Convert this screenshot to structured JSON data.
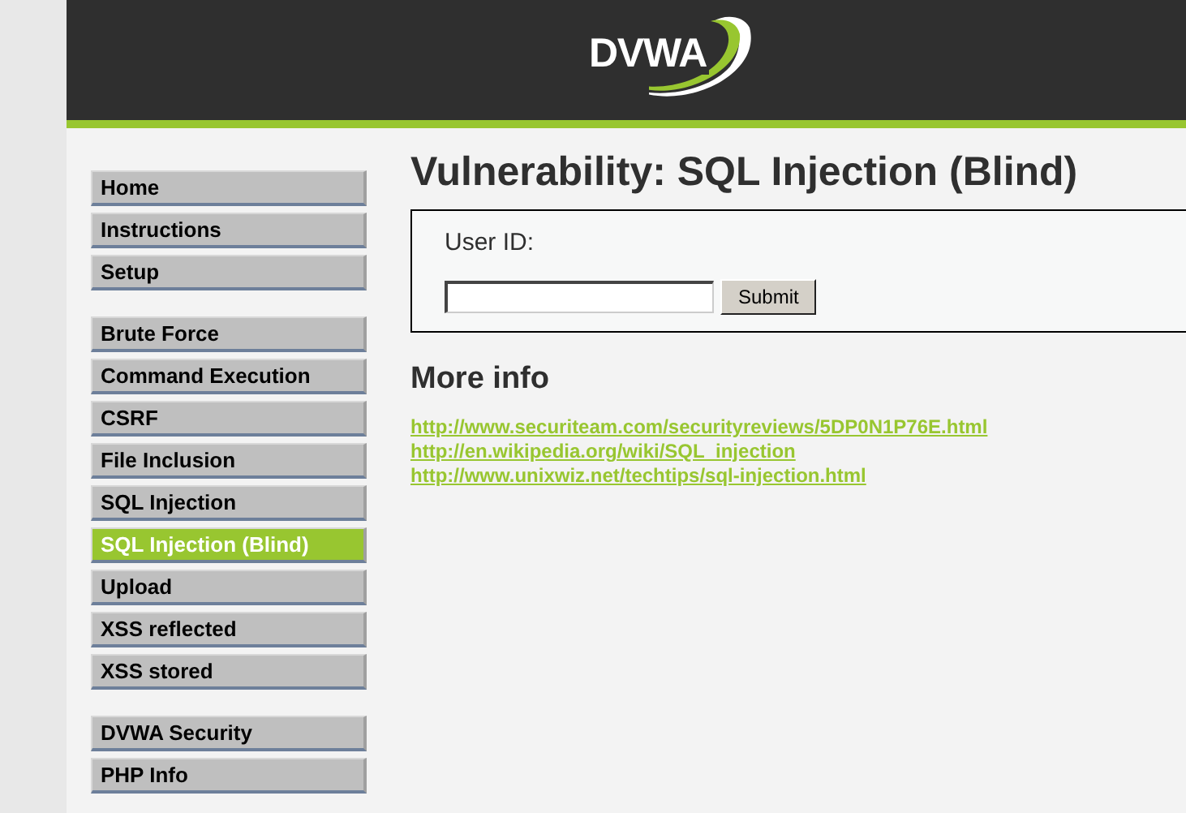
{
  "header": {
    "logo": "DVWA"
  },
  "menu_groups": [
    {
      "items": [
        {
          "label": "Home",
          "selected": false
        },
        {
          "label": "Instructions",
          "selected": false
        },
        {
          "label": "Setup",
          "selected": false
        }
      ]
    },
    {
      "items": [
        {
          "label": "Brute Force",
          "selected": false
        },
        {
          "label": "Command Execution",
          "selected": false
        },
        {
          "label": "CSRF",
          "selected": false
        },
        {
          "label": "File Inclusion",
          "selected": false
        },
        {
          "label": "SQL Injection",
          "selected": false
        },
        {
          "label": "SQL Injection (Blind)",
          "selected": true
        },
        {
          "label": "Upload",
          "selected": false
        },
        {
          "label": "XSS reflected",
          "selected": false
        },
        {
          "label": "XSS stored",
          "selected": false
        }
      ]
    },
    {
      "items": [
        {
          "label": "DVWA Security",
          "selected": false
        },
        {
          "label": "PHP Info",
          "selected": false
        }
      ]
    }
  ],
  "title": "Vulnerability: SQL Injection (Blind)",
  "form": {
    "label": "User ID:",
    "button": "Submit"
  },
  "more_info": {
    "heading": "More info",
    "links": [
      "http://www.securiteam.com/securityreviews/5DP0N1P76E.html",
      "http://en.wikipedia.org/wiki/SQL_injection",
      "http://www.unixwiz.net/techtips/sql-injection.html"
    ]
  }
}
